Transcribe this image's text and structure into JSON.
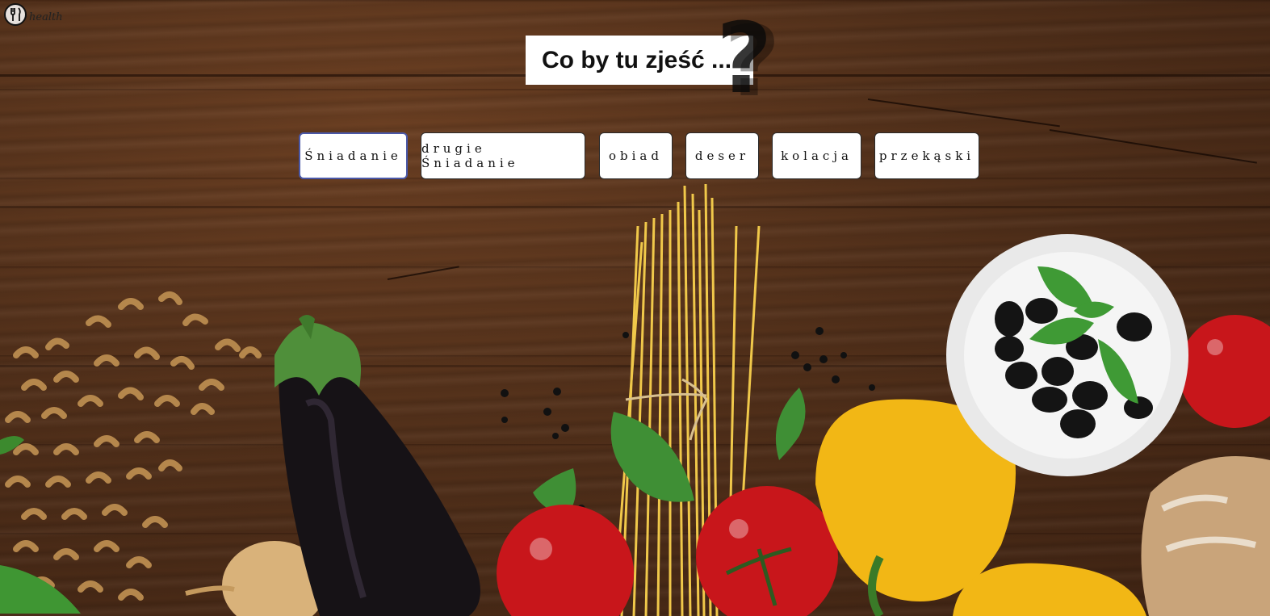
{
  "logo": {
    "icon": "cutlery-icon",
    "text": "health"
  },
  "title": {
    "text": "Co by tu zjeść ...",
    "mark": "?"
  },
  "nav": {
    "items": [
      {
        "label": "Śniadanie",
        "active": true
      },
      {
        "label": "drugie Śniadanie",
        "active": false
      },
      {
        "label": "obiad",
        "active": false
      },
      {
        "label": "deser",
        "active": false
      },
      {
        "label": "kolacja",
        "active": false
      },
      {
        "label": "przekąski",
        "active": false
      }
    ]
  },
  "colors": {
    "wood": "#52301a",
    "active_border": "#4a58a8",
    "button_bg": "#ffffff"
  }
}
